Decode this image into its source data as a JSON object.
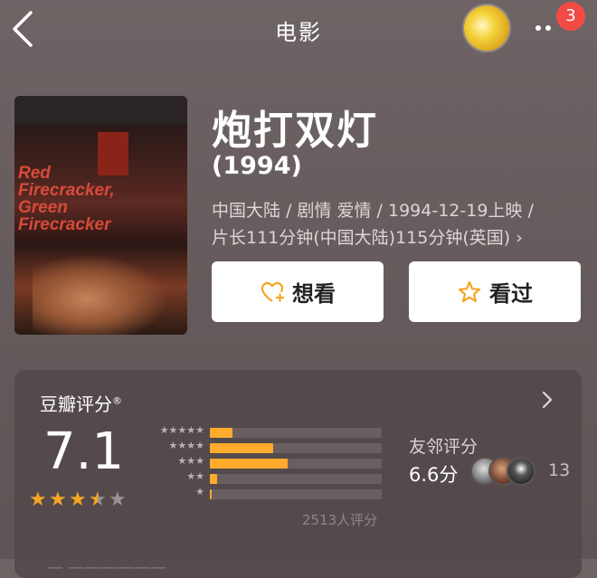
{
  "header": {
    "back_icon": "chevron-left-icon",
    "title": "电影",
    "badge_count": "3"
  },
  "movie": {
    "poster_text": [
      "Red",
      "Firecracker,",
      "Green",
      "Firecracker"
    ],
    "title": "炮打双灯",
    "year": "(1994)",
    "info_line1": "中国大陆 / 剧情 爱情 / 1994-12-19上映 /",
    "info_line2": "片长111分钟(中国大陆)115分钟(英国) ›"
  },
  "actions": {
    "want_label": "想看",
    "want_icon": "heart-plus-icon",
    "seen_label": "看过",
    "seen_icon": "star-outline-icon"
  },
  "rating": {
    "label": "豆瓣评分",
    "label_mark": "®",
    "score": "7.1",
    "stars_filled": 3.5,
    "distribution": [
      {
        "stars": "★★★★★",
        "fraction": 0.13
      },
      {
        "stars": "★★★★",
        "fraction": 0.37
      },
      {
        "stars": "★★★",
        "fraction": 0.45
      },
      {
        "stars": "★★",
        "fraction": 0.04
      },
      {
        "stars": "★",
        "fraction": 0.01
      }
    ],
    "count": "2513人评分",
    "friend_label": "友邻评分",
    "friend_score": "6.6分",
    "friend_count": "13",
    "bottom_text": "— ——————"
  },
  "colors": {
    "accent": "#ffac2d",
    "badge": "#f24b45",
    "star": "#f5a623"
  }
}
